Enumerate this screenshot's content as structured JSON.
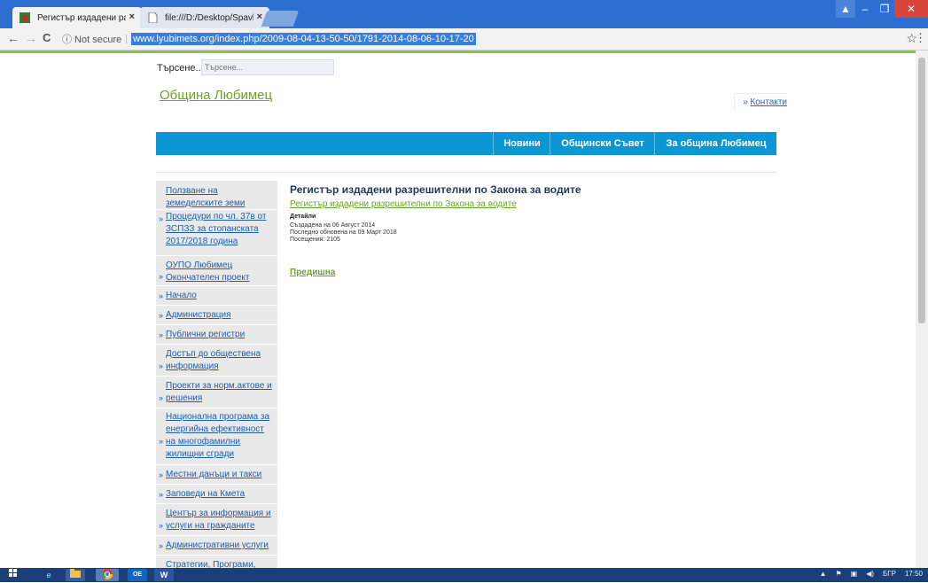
{
  "browser": {
    "tabs": [
      {
        "label": "Регистър издадени разр"
      },
      {
        "label": "file:///D:/Desktop/Spavk"
      }
    ],
    "close_glyph": "×",
    "window_controls": [
      "▲",
      "–",
      "❐",
      "✕"
    ],
    "nav": {
      "back": "←",
      "forward": "→",
      "reload": "C"
    },
    "security_label": "ⓘ Not secure",
    "url": "www.lyubimets.org/index.php/2009-08-04-13-50-50/1791-2014-08-06-10-17-20",
    "star": "☆",
    "menu": "⋮"
  },
  "page": {
    "search_label": "Търсене...",
    "search_placeholder": "Търсене...",
    "site_title": "Община Любимец",
    "contacts_bullet": "»",
    "contacts_label": "Контакти",
    "nav": [
      {
        "label": "Новини"
      },
      {
        "label": "Общински Съвет"
      },
      {
        "label": "За община Любимец"
      }
    ],
    "sidebar": [
      {
        "label": "Ползване на земеделските земи"
      },
      {
        "label": "Процедури по чл. 37в от ЗСПЗЗ за стопанската 2017/2018 година"
      },
      {
        "label": "ОУПО Любимец Окончателен проект"
      },
      {
        "label": "Начало"
      },
      {
        "label": "Администрация"
      },
      {
        "label": "Публични регистри"
      },
      {
        "label": "Достъп до обществена информация"
      },
      {
        "label": "Проекти за норм.актове и решения"
      },
      {
        "label": "Национална програма за енергийна ефективност на многофамилни жилищни сгради"
      },
      {
        "label": "Местни данъци и такси"
      },
      {
        "label": "Заповеди на Кмета"
      },
      {
        "label": "Център за информация и услуги на гражданите"
      },
      {
        "label": "Административни услуги"
      },
      {
        "label": "Стратегии, Програми,"
      }
    ],
    "article": {
      "title": "Регистър издадени разрешителни по Закона за водите",
      "link": "Регистър издадени разрешителни по Закона за водите",
      "details_heading": "Детайли",
      "created": "Създадена на 06 Август 2014",
      "updated": "Последно обновена на 09 Март 2018",
      "hits": "Посещения: 2105",
      "prev": "Предишна"
    }
  },
  "taskbar": {
    "tray_lang": "БГР",
    "clock": "17:50"
  },
  "colors": {
    "accent_green": "#6aa428",
    "nav_blue": "#0c96d5",
    "taskbar": "#1c3f78"
  }
}
